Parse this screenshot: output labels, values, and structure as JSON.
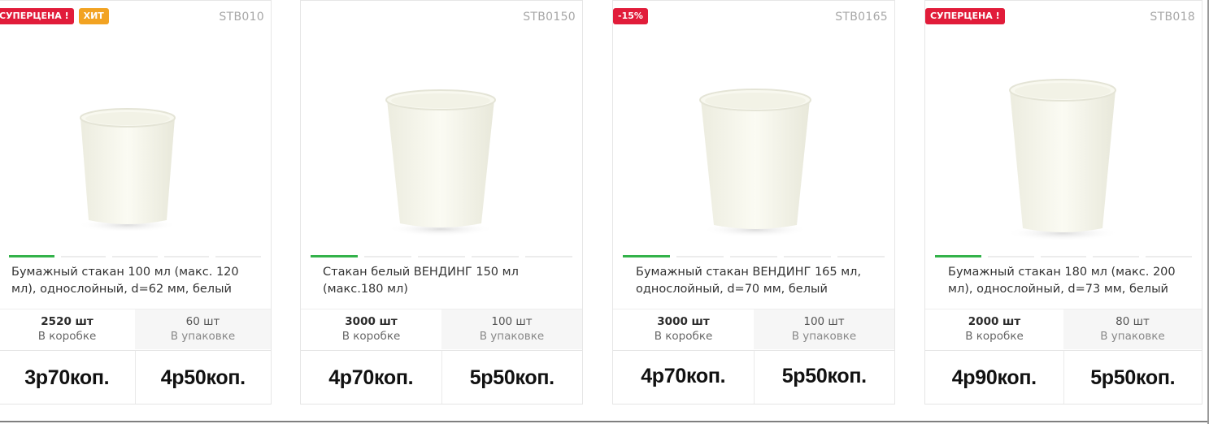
{
  "products": [
    {
      "badges": [
        {
          "label": "СУПЕРЦЕНА !",
          "color": "#e11c3a"
        },
        {
          "label": "ХИТ",
          "color": "#f2a322"
        }
      ],
      "sku": "STB010",
      "title": "Бумажный стакан 100 мл (макс. 120 мл), однослойный, d=62 мм, белый",
      "box_qty": "2520 шт",
      "box_label": "В коробке",
      "pack_qty": "60 шт",
      "pack_label": "В упаковке",
      "price_box": "3р70коп.",
      "price_pack": "4р50коп.",
      "slider_active": 1,
      "slider_total": 5
    },
    {
      "badges": [],
      "sku": "STB0150",
      "title": "Стакан белый ВЕНДИНГ 150 мл (макс.180 мл)",
      "box_qty": "3000 шт",
      "box_label": "В коробке",
      "pack_qty": "100 шт",
      "pack_label": "В упаковке",
      "price_box": "4р70коп.",
      "price_pack": "5р50коп.",
      "slider_active": 1,
      "slider_total": 5
    },
    {
      "badges": [
        {
          "label": "-15%",
          "color": "#e11c3a"
        }
      ],
      "sku": "STB0165",
      "title": "Бумажный стакан ВЕНДИНГ 165 мл, однослойный, d=70 мм, белый",
      "box_qty": "3000 шт",
      "box_label": "В коробке",
      "pack_qty": "100 шт",
      "pack_label": "В упаковке",
      "price_box": "4р70коп.",
      "price_pack": "5р50коп.",
      "slider_active": 1,
      "slider_total": 5
    },
    {
      "badges": [
        {
          "label": "СУПЕРЦЕНА !",
          "color": "#e11c3a"
        }
      ],
      "sku": "STB018",
      "title": "Бумажный стакан 180 мл (макс. 200 мл), однослойный, d=73 мм, белый",
      "box_qty": "2000 шт",
      "box_label": "В коробке",
      "pack_qty": "80 шт",
      "pack_label": "В упаковке",
      "price_box": "4р90коп.",
      "price_pack": "5р50коп.",
      "slider_active": 1,
      "slider_total": 5
    }
  ],
  "colors": {
    "accent_green": "#33b24a",
    "badge_red": "#e11c3a",
    "badge_orange": "#f2a322"
  }
}
